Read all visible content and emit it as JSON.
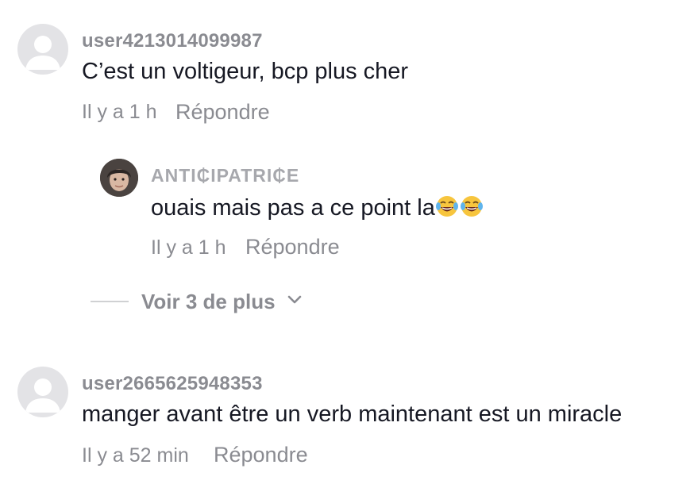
{
  "comments": [
    {
      "username": "user4213014099987",
      "text": "C’est un voltigeur, bcp plus cher",
      "time": "Il y a 1 h",
      "reply_label": "Répondre",
      "replies": [
        {
          "username": "ANTI₵IPATRI₵E",
          "text": "ouais mais pas a ce point la",
          "emoji": "😂😂",
          "time": "Il y a 1 h",
          "reply_label": "Répondre"
        }
      ],
      "view_more_label": "Voir 3 de plus"
    },
    {
      "username": "user2665625948353",
      "text": "manger avant être un verb maintenant est un miracle",
      "time": "Il y a 52 min",
      "reply_label": "Répondre"
    }
  ],
  "colors": {
    "primary_text": "#161823",
    "secondary_text": "#8a8b91",
    "avatar_bg": "#e3e3e6",
    "avatar_fg": "#ffffff"
  },
  "icons": {
    "default_avatar": "person-silhouette-icon",
    "view_more": "chevron-down-icon",
    "emoji": "face-with-tears-of-joy-icon"
  }
}
